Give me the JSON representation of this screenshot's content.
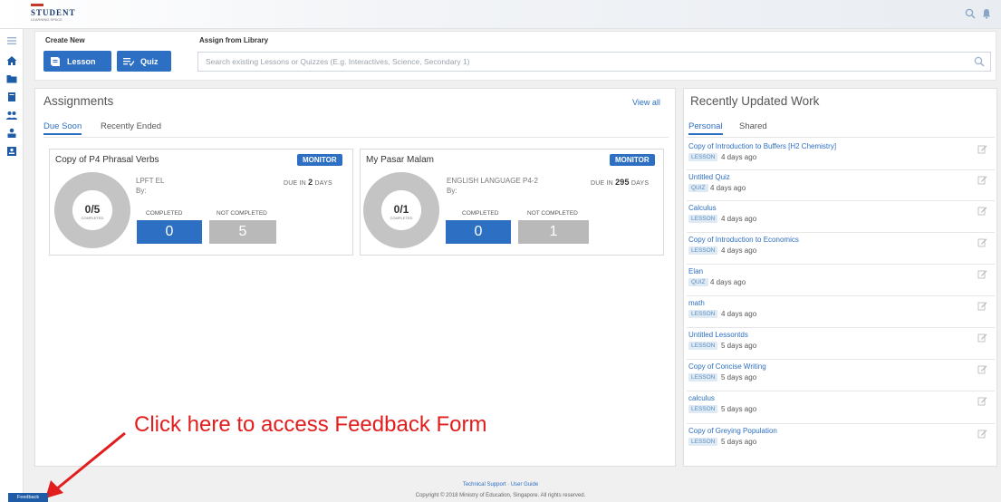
{
  "header": {
    "logo_text": "STUDENT",
    "logo_sub": "LEARNING SPACE"
  },
  "create": {
    "title": "Create New",
    "lesson_label": "Lesson",
    "quiz_label": "Quiz",
    "assign_title": "Assign from Library",
    "search_placeholder": "Search existing Lessons or Quizzes (E.g. Interactives, Science, Secondary 1)"
  },
  "assignments": {
    "title": "Assignments",
    "view_all": "View all",
    "tabs": [
      "Due Soon",
      "Recently Ended"
    ],
    "cards": [
      {
        "title": "Copy of P4 Phrasal Verbs",
        "monitor": "MONITOR",
        "subject": "LPFT EL",
        "by": "By:",
        "due_prefix": "DUE IN",
        "due_num": "2",
        "due_unit": "DAYS",
        "ratio": "0/5",
        "ratio_sub": "COMPLETED",
        "completed_label": "COMPLETED",
        "not_completed_label": "NOT COMPLETED",
        "completed": "0",
        "not_completed": "5"
      },
      {
        "title": "My Pasar Malam",
        "monitor": "MONITOR",
        "subject": "ENGLISH LANGUAGE P4-2",
        "by": "By:",
        "due_prefix": "DUE IN",
        "due_num": "295",
        "due_unit": "DAYS",
        "ratio": "0/1",
        "ratio_sub": "COMPLETED",
        "completed_label": "COMPLETED",
        "not_completed_label": "NOT COMPLETED",
        "completed": "0",
        "not_completed": "1"
      }
    ]
  },
  "recent": {
    "title": "Recently Updated Work",
    "tabs": [
      "Personal",
      "Shared"
    ],
    "items": [
      {
        "title": "Copy of Introduction to Buffers [H2 Chemistry]",
        "type": "LESSON",
        "ago": "4 days ago"
      },
      {
        "title": "Untitled Quiz",
        "type": "QUIZ",
        "ago": "4 days ago"
      },
      {
        "title": "Calculus",
        "type": "LESSON",
        "ago": "4 days ago"
      },
      {
        "title": "Copy of Introduction to Economics",
        "type": "LESSON",
        "ago": "4 days ago"
      },
      {
        "title": "Elan",
        "type": "QUIZ",
        "ago": "4 days ago"
      },
      {
        "title": "math",
        "type": "LESSON",
        "ago": "4 days ago"
      },
      {
        "title": "Untitled Lessontds",
        "type": "LESSON",
        "ago": "5 days ago"
      },
      {
        "title": "Copy of Concise Writing",
        "type": "LESSON",
        "ago": "5 days ago"
      },
      {
        "title": "calculus",
        "type": "LESSON",
        "ago": "5 days ago"
      },
      {
        "title": "Copy of Greying Population",
        "type": "LESSON",
        "ago": "5 days ago"
      }
    ]
  },
  "annotation": "Click here to access Feedback Form",
  "feedback_label": "Feedback",
  "footer": {
    "links": "Technical Support  ·  User Guide",
    "copyright": "Copyright © 2018 Ministry of Education, Singapore. All rights reserved."
  },
  "colors": {
    "accent": "#2d6fc2",
    "grey_box": "#b9b9b9",
    "annotation": "#e21d1d"
  }
}
